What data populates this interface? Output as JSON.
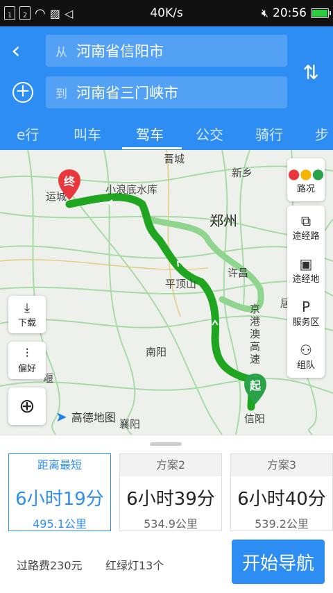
{
  "status": {
    "sim1": "1",
    "sim2": "2",
    "speed": "40K/s",
    "time": "20:56",
    "battery_level": 1.0
  },
  "route_form": {
    "from_tag": "从",
    "from_value": "河南省信阳市",
    "to_tag": "到",
    "to_value": "河南省三门峡市"
  },
  "tabs": [
    "e行",
    "叫车",
    "驾车",
    "公交",
    "骑行",
    "步"
  ],
  "active_tab": "驾车",
  "map": {
    "labels": {
      "jincheng": "晋城",
      "xinxiang": "新乡",
      "xiaolangdi": "小浪底水库",
      "yuncheng": "运城",
      "zhengzhou": "郑州",
      "xuchang": "许昌",
      "pingdingshan": "平顶山",
      "nanyang": "南阳",
      "xiangyang": "襄阳",
      "xinyang": "信阳",
      "jinggangao": "京港澳高速",
      "yan": "堰",
      "ju": "居"
    },
    "end_marker": "终",
    "start_marker": "起",
    "logo": "高德地图",
    "side_buttons": [
      "路况",
      "途经路",
      "途经地",
      "服务区",
      "组队"
    ],
    "left_buttons": [
      "下载",
      "偏好"
    ]
  },
  "plans": [
    {
      "header": "距离最短",
      "time": "6小时19分",
      "distance": "495.1公里"
    },
    {
      "header": "方案2",
      "time": "6小时39分",
      "distance": "534.9公里"
    },
    {
      "header": "方案3",
      "time": "6小时40分",
      "distance": "539.2公里"
    }
  ],
  "trip_info": {
    "toll": "过路费230元",
    "lights": "红绿灯13个"
  },
  "start_nav": "开始导航",
  "colors": {
    "accent": "#2e8df3",
    "route_main": "#1fa51f",
    "route_alt": "#8fd58f",
    "end_marker": "#e8383d",
    "start_marker": "#2aa24a"
  }
}
